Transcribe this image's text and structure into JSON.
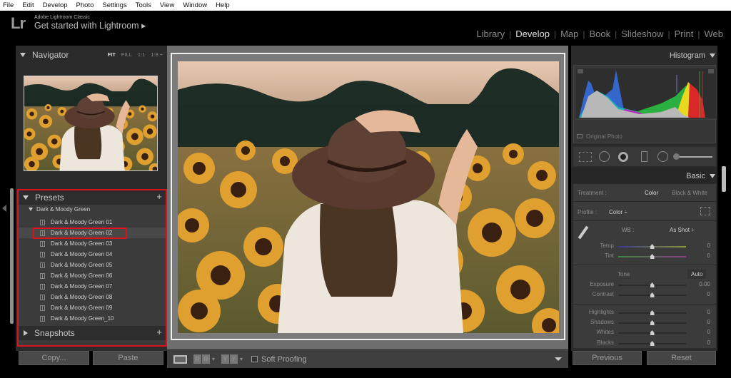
{
  "menubar": [
    "File",
    "Edit",
    "Develop",
    "Photo",
    "Settings",
    "Tools",
    "View",
    "Window",
    "Help"
  ],
  "identity": {
    "logo": "Lr",
    "app_name": "Adobe Lightroom Classic",
    "tagline": "Get started with Lightroom ▸"
  },
  "modules": [
    {
      "label": "Library",
      "active": false
    },
    {
      "label": "Develop",
      "active": true
    },
    {
      "label": "Map",
      "active": false
    },
    {
      "label": "Book",
      "active": false
    },
    {
      "label": "Slideshow",
      "active": false
    },
    {
      "label": "Print",
      "active": false
    },
    {
      "label": "Web",
      "active": false
    }
  ],
  "navigator": {
    "title": "Navigator",
    "zoom": {
      "fit": "FIT",
      "fill": "FILL",
      "one": "1:1",
      "ratio": "1:8 ÷"
    }
  },
  "presets": {
    "title": "Presets",
    "add": "+",
    "group": "Dark & Moody Green",
    "items": [
      "Dark & Moody Green 01",
      "Dark & Moody Green 02",
      "Dark & Moody Green 03",
      "Dark & Moody Green 04",
      "Dark & Moody Green 05",
      "Dark & Moody Green 06",
      "Dark & Moody Green 07",
      "Dark & Moody Green 08",
      "Dark & Moody Green 09",
      "Dark & Moody Green_10"
    ],
    "selected_index": 1
  },
  "snapshots": {
    "title": "Snapshots",
    "add": "+"
  },
  "left_buttons": {
    "copy": "Copy...",
    "paste": "Paste"
  },
  "toolbar": {
    "soft_proofing": "Soft Proofing",
    "soft_proofing_checked": false
  },
  "histogram": {
    "title": "Histogram",
    "original_photo": "Original Photo"
  },
  "basic": {
    "title": "Basic",
    "treatment_label": "Treatment :",
    "treatment_color": "Color",
    "treatment_bw": "Black & White",
    "profile_label": "Profile :",
    "profile_value": "Color ÷",
    "wb_label": "WB :",
    "wb_value": "As Shot ÷",
    "tone_label": "Tone",
    "auto": "Auto",
    "sliders": [
      {
        "label": "Temp",
        "value": "0",
        "pos": 0.5
      },
      {
        "label": "Tint",
        "value": "0",
        "pos": 0.5
      },
      {
        "label": "Exposure",
        "value": "0.00",
        "pos": 0.5
      },
      {
        "label": "Contrast",
        "value": "0",
        "pos": 0.5
      },
      {
        "label": "Highlights",
        "value": "0",
        "pos": 0.5
      },
      {
        "label": "Shadows",
        "value": "0",
        "pos": 0.5
      },
      {
        "label": "Whites",
        "value": "0",
        "pos": 0.5
      },
      {
        "label": "Blacks",
        "value": "0",
        "pos": 0.5
      }
    ]
  },
  "right_buttons": {
    "previous": "Previous",
    "reset": "Reset"
  },
  "colors": {
    "highlight_red": "#d8141c",
    "panel_bg": "#2b2b2b",
    "active_module": "#e2e2e2"
  }
}
